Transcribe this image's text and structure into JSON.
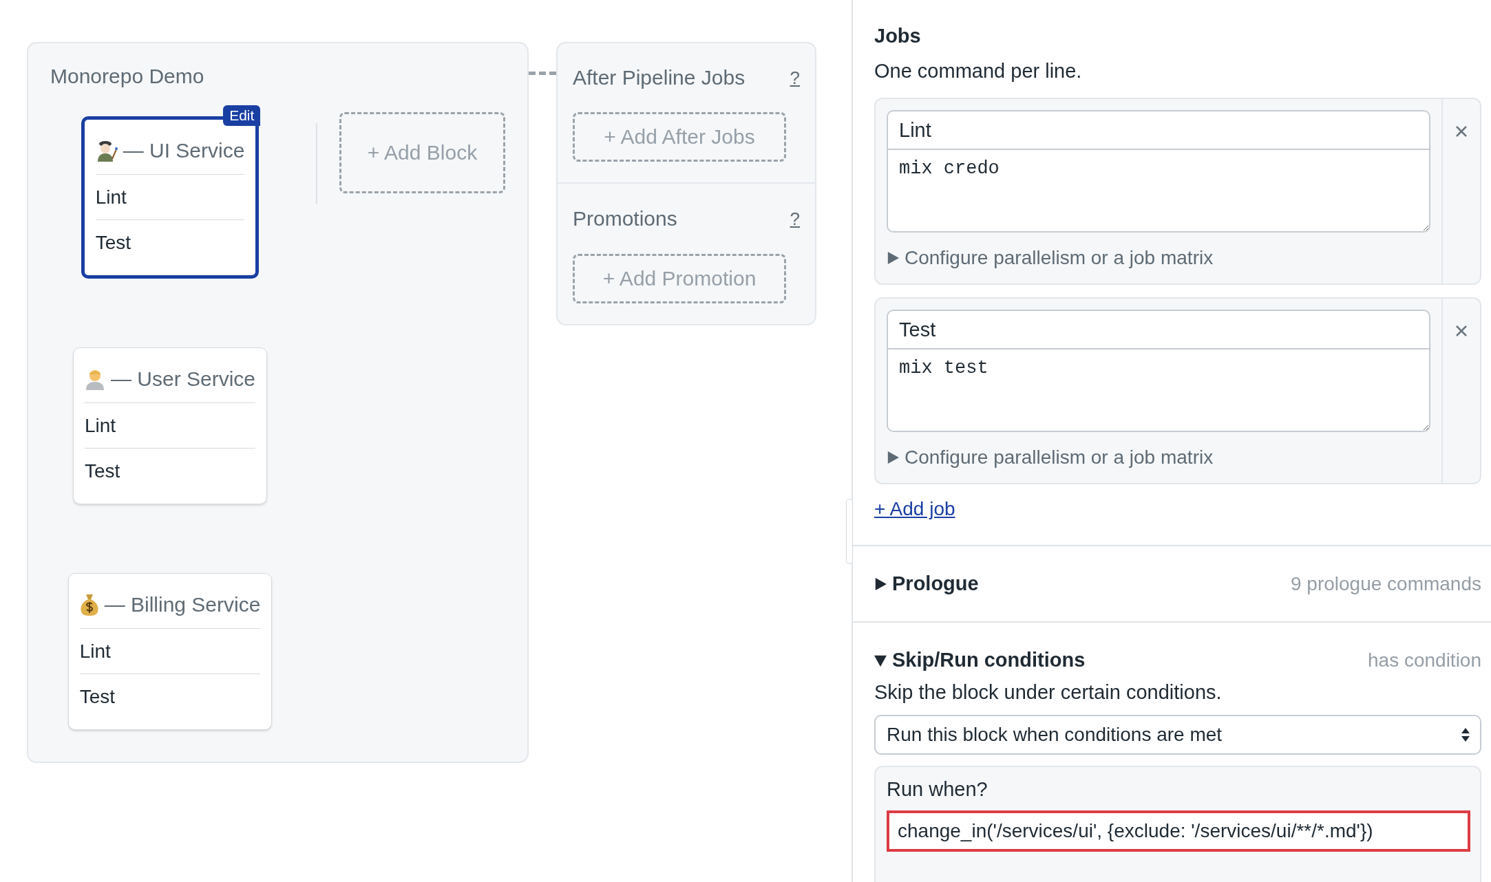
{
  "pipeline": {
    "title": "Monorepo Demo",
    "add_block": "+ Add Block",
    "blocks": [
      {
        "title": "— UI Service",
        "selected": true,
        "badge": "Edit",
        "jobs": [
          "Lint",
          "Test"
        ]
      },
      {
        "title": "— User Service",
        "selected": false,
        "jobs": [
          "Lint",
          "Test"
        ]
      },
      {
        "title": "— Billing Service",
        "selected": false,
        "jobs": [
          "Lint",
          "Test"
        ]
      }
    ]
  },
  "after_pipeline": {
    "title": "After Pipeline Jobs",
    "help": "?",
    "button": "+ Add After Jobs"
  },
  "promotions": {
    "title": "Promotions",
    "help": "?",
    "button": "+ Add Promotion"
  },
  "editor": {
    "jobs_title": "Jobs",
    "jobs_hint": "One command per line.",
    "jobs": [
      {
        "name": "Lint",
        "commands": "mix credo",
        "config": "Configure parallelism or a job matrix",
        "expanded": false
      },
      {
        "name": "Test",
        "commands": "mix test",
        "config": "Configure parallelism or a job matrix",
        "expanded": false
      }
    ],
    "add_job": "+ Add job",
    "prologue": {
      "title": "Prologue",
      "summary": "9 prologue commands",
      "expanded": false
    },
    "conditions": {
      "title": "Skip/Run conditions",
      "summary": "has condition",
      "expanded": true,
      "description": "Skip the block under certain conditions.",
      "mode": "Run this block when conditions are met",
      "run_when_label": "Run when?",
      "run_when_value": "change_in('/services/ui', {exclude: '/services/ui/**/*.md'})",
      "highlighted": true
    }
  }
}
